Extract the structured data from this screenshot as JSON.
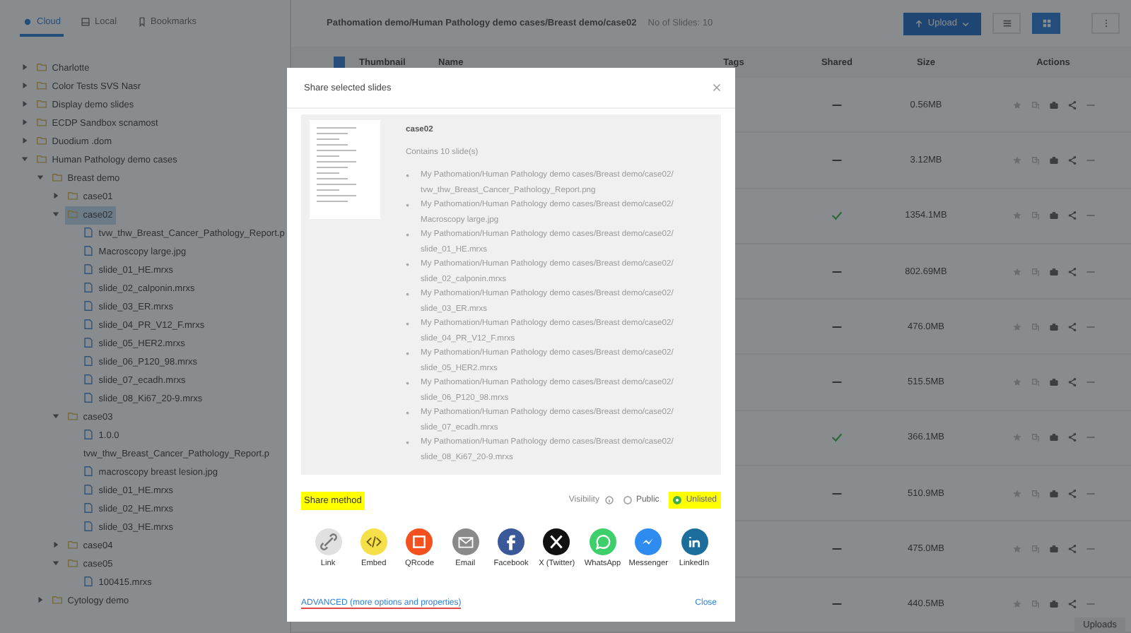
{
  "nav_tabs": [
    {
      "label": "Cloud",
      "kind": "cloud",
      "selected": true
    },
    {
      "label": "Local",
      "kind": "disk",
      "selected": false
    },
    {
      "label": "Bookmarks",
      "kind": "bookmark",
      "selected": false
    }
  ],
  "tree": [
    {
      "label": "Charlotte",
      "kind": "folder",
      "expanded": false,
      "selected": false
    },
    {
      "label": "Color Tests SVS Nasr",
      "kind": "folder",
      "expanded": false,
      "selected": false
    },
    {
      "label": "Display demo slides",
      "kind": "folder",
      "expanded": false,
      "selected": false
    },
    {
      "label": "ECDP Sandbox scnamost",
      "kind": "folder",
      "expanded": false,
      "selected": false
    },
    {
      "label": "Duodium .dom",
      "kind": "folder",
      "expanded": false,
      "selected": false
    },
    {
      "label": "Human Pathology demo cases",
      "kind": "folder",
      "expanded": true,
      "selected": false,
      "children": [
        {
          "label": "Breast demo",
          "kind": "folder",
          "expanded": true,
          "selected": false,
          "children": [
            {
              "label": "case01",
              "kind": "folder",
              "expanded": false,
              "selected": false
            },
            {
              "label": "case02",
              "kind": "folder",
              "expanded": true,
              "selected": true,
              "children": [
                {
                  "label": "tvw_thw_Breast_Cancer_Pathology_Report.p",
                  "kind": "file",
                  "selected": false
                },
                {
                  "label": "Macroscopy large.jpg",
                  "kind": "file",
                  "selected": false
                },
                {
                  "label": "slide_01_HE.mrxs",
                  "kind": "file",
                  "selected": false
                },
                {
                  "label": "slide_02_calponin.mrxs",
                  "kind": "file",
                  "selected": false
                },
                {
                  "label": "slide_03_ER.mrxs",
                  "kind": "file",
                  "selected": false
                },
                {
                  "label": "slide_04_PR_V12_F.mrxs",
                  "kind": "file",
                  "selected": false
                },
                {
                  "label": "slide_05_HER2.mrxs",
                  "kind": "file",
                  "selected": false
                },
                {
                  "label": "slide_06_P120_98.mrxs",
                  "kind": "file",
                  "selected": false
                },
                {
                  "label": "slide_07_ecadh.mrxs",
                  "kind": "file",
                  "selected": false
                },
                {
                  "label": "slide_08_Ki67_20-9.mrxs",
                  "kind": "file",
                  "selected": false
                }
              ]
            },
            {
              "label": "case03",
              "kind": "folder",
              "expanded": true,
              "selected": false,
              "children": [
                {
                  "label": "1.0.0 tvw_thw_Breast_Cancer_Pathology_Report.p",
                  "kind": "file",
                  "selected": false
                },
                {
                  "label": "macroscopy breast lesion.jpg",
                  "kind": "file",
                  "selected": false
                },
                {
                  "label": "slide_01_HE.mrxs",
                  "kind": "file",
                  "selected": false
                },
                {
                  "label": "slide_02_HE.mrxs",
                  "kind": "file",
                  "selected": false
                },
                {
                  "label": "slide_03_HE.mrxs",
                  "kind": "file",
                  "selected": false
                }
              ]
            },
            {
              "label": "case04",
              "kind": "folder",
              "expanded": false,
              "selected": false
            },
            {
              "label": "case05",
              "kind": "folder",
              "expanded": true,
              "selected": false,
              "children": [
                {
                  "label": "100415.mrxs",
                  "kind": "file",
                  "selected": false
                }
              ]
            }
          ]
        },
        {
          "label": "Cytology demo",
          "kind": "folder",
          "expanded": false,
          "selected": false
        }
      ]
    }
  ],
  "breadcrumb": "Pathomation demo/Human Pathology demo cases/Breast demo/case02",
  "slide_count": "No of Slides: 10",
  "upload_button": "Upload",
  "view_buttons": [
    {
      "kind": "list",
      "selected": false
    },
    {
      "kind": "grid",
      "selected": true
    }
  ],
  "table": {
    "header_checked": true,
    "columns": [
      "Thumbnail",
      "Name",
      "Tags",
      "Shared",
      "Size",
      "Actions"
    ],
    "rows": [
      {
        "shared": false,
        "size": "0.56MB"
      },
      {
        "shared": false,
        "size": "3.12MB"
      },
      {
        "shared": true,
        "size": "1354.1MB"
      },
      {
        "shared": false,
        "size": "802.69MB"
      },
      {
        "shared": false,
        "size": "476.0MB"
      },
      {
        "shared": false,
        "size": "515.5MB"
      },
      {
        "shared": true,
        "size": "366.1MB"
      },
      {
        "shared": false,
        "size": "510.9MB"
      },
      {
        "shared": false,
        "size": "475.0MB"
      },
      {
        "shared": false,
        "size": "440.5MB"
      }
    ]
  },
  "uploads_label": "Uploads",
  "dialog": {
    "title": "Share selected slides",
    "folder": "case02",
    "count": "Contains 10 slide(s)",
    "paths": [
      "My Pathomation/Human Pathology demo cases/Breast demo/case02/tvw_thw_Breast_Cancer_Pathology_Report.png",
      "My Pathomation/Human Pathology demo cases/Breast demo/case02/Macroscopy large.jpg",
      "My Pathomation/Human Pathology demo cases/Breast demo/case02/slide_01_HE.mrxs",
      "My Pathomation/Human Pathology demo cases/Breast demo/case02/slide_02_calponin.mrxs",
      "My Pathomation/Human Pathology demo cases/Breast demo/case02/slide_03_ER.mrxs",
      "My Pathomation/Human Pathology demo cases/Breast demo/case02/slide_04_PR_V12_F.mrxs",
      "My Pathomation/Human Pathology demo cases/Breast demo/case02/slide_05_HER2.mrxs",
      "My Pathomation/Human Pathology demo cases/Breast demo/case02/slide_06_P120_98.mrxs",
      "My Pathomation/Human Pathology demo cases/Breast demo/case02/slide_07_ecadh.mrxs",
      "My Pathomation/Human Pathology demo cases/Breast demo/case02/slide_08_Ki67_20-9.mrxs"
    ],
    "share_method": {
      "label": "Share method",
      "highlighted": true
    },
    "visibility_label": "Visibility",
    "visibility_options": [
      {
        "label": "Public",
        "selected": false,
        "highlighted": false
      },
      {
        "label": "Unlisted",
        "selected": true,
        "highlighted": true
      }
    ],
    "share_options": [
      {
        "label": "Link",
        "kind": "link",
        "color": "#e0e0e0"
      },
      {
        "label": "Embed",
        "kind": "embed",
        "color": "#f5e04a"
      },
      {
        "label": "QRcode",
        "kind": "qr",
        "color": "#f4511e"
      },
      {
        "label": "Email",
        "kind": "email",
        "color": "#8a8a8a"
      },
      {
        "label": "Facebook",
        "kind": "facebook",
        "color": "#3b5998"
      },
      {
        "label": "X (Twitter)",
        "kind": "x",
        "color": "#111111"
      },
      {
        "label": "WhatsApp",
        "kind": "whatsapp",
        "color": "#3ccf6a"
      },
      {
        "label": "Messenger",
        "kind": "messenger",
        "color": "#2e8cf0"
      },
      {
        "label": "LinkedIn",
        "kind": "linkedin",
        "color": "#1b6e9c"
      }
    ],
    "advanced_link": "ADVANCED (more options and properties)",
    "close_button": "Close"
  }
}
